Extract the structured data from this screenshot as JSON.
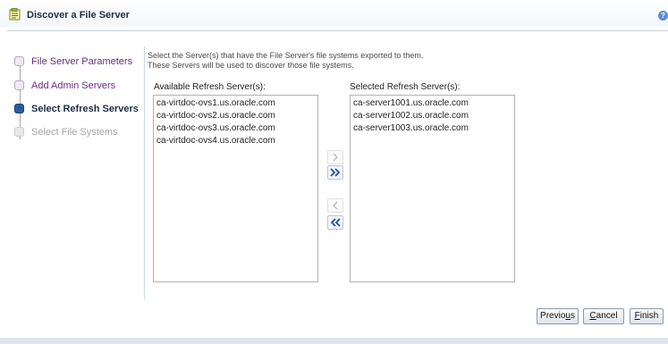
{
  "title": "Discover a File Server",
  "help_glyph": "?",
  "train": {
    "steps": [
      {
        "label": "File Server Parameters",
        "state": "visited"
      },
      {
        "label": "Add Admin Servers",
        "state": "visited"
      },
      {
        "label": "Select Refresh Servers",
        "state": "current"
      },
      {
        "label": "Select File Systems",
        "state": "disabled"
      }
    ]
  },
  "instructions": {
    "line1": "Select the Server(s) that have the File Server's file systems exported to them.",
    "line2": "These Servers will be used to discover those file systems."
  },
  "available": {
    "label": "Available Refresh Server(s):",
    "items": [
      "ca-virtdoc-ovs1.us.oracle.com",
      "ca-virtdoc-ovs2.us.oracle.com",
      "ca-virtdoc-ovs3.us.oracle.com",
      "ca-virtdoc-ovs4.us.oracle.com"
    ]
  },
  "selected": {
    "label": "Selected Refresh Server(s):",
    "items": [
      "ca-server1001.us.oracle.com",
      "ca-server1002.us.oracle.com",
      "ca-server1003.us.oracle.com"
    ]
  },
  "shuttle": {
    "move_icon": "chevron-right-icon",
    "move_all_icon": "double-chevron-right-icon",
    "remove_icon": "chevron-left-icon",
    "remove_all_icon": "double-chevron-left-icon"
  },
  "buttons": {
    "previous": {
      "before": "Previo",
      "mnemonic": "u",
      "after": "s"
    },
    "cancel": {
      "before": "",
      "mnemonic": "C",
      "after": "ancel"
    },
    "finish": {
      "before": "",
      "mnemonic": "F",
      "after": "inish"
    }
  },
  "colors": {
    "accent": "#2a5a9a",
    "visited_link": "#6b2e80",
    "disabled_text": "#a5a5a5"
  }
}
